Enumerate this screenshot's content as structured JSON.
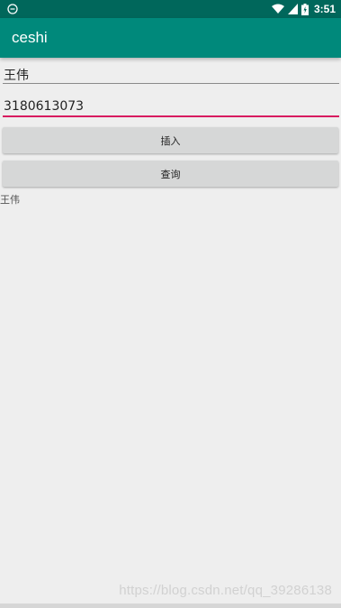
{
  "status_bar": {
    "time": "3:51",
    "icons": [
      "app-notification-icon",
      "wifi-icon",
      "cell-signal-icon",
      "battery-icon"
    ],
    "color": "#00675b"
  },
  "app_bar": {
    "title": "ceshi",
    "color": "#00897b"
  },
  "form": {
    "name_value": "王伟",
    "phone_value": "3180613073",
    "phone_underline_color": "#d81b60"
  },
  "buttons": {
    "insert_label": "插入",
    "query_label": "查询"
  },
  "result": {
    "text": "王伟"
  },
  "watermark": {
    "text": "https://blog.csdn.net/qq_39286138"
  }
}
